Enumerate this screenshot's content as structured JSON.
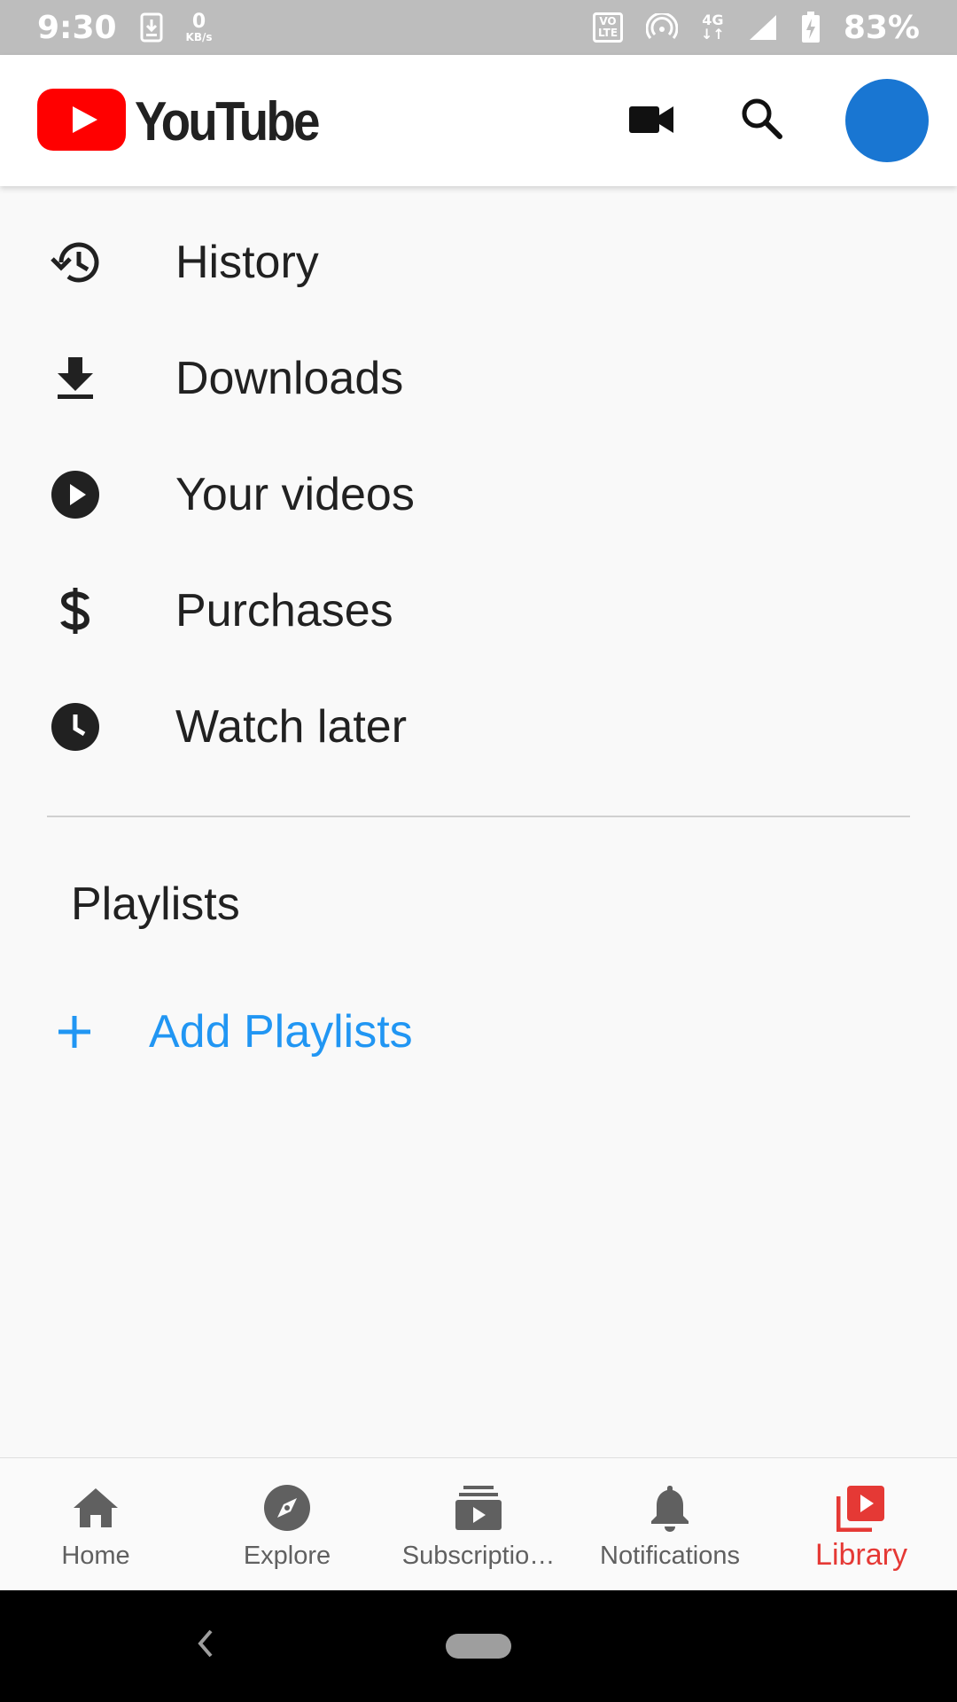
{
  "status_bar": {
    "time": "9:30",
    "net_speed_value": "0",
    "net_speed_unit": "KB/s",
    "volte_line1": "VO",
    "volte_line2": "LTE",
    "network_type": "4G",
    "battery_percent": "83%"
  },
  "app_bar": {
    "logo_text": "YouTube",
    "icons": [
      "video-camera-icon",
      "search-icon"
    ],
    "avatar_color": "#1976d2",
    "brand_red": "#ff0000"
  },
  "menu": {
    "items": [
      {
        "label": "History",
        "icon": "history-icon"
      },
      {
        "label": "Downloads",
        "icon": "download-icon"
      },
      {
        "label": "Your videos",
        "icon": "play-circle-icon"
      },
      {
        "label": "Purchases",
        "icon": "dollar-icon"
      },
      {
        "label": "Watch later",
        "icon": "clock-icon"
      }
    ]
  },
  "playlists": {
    "section_title": "Playlists",
    "add_label": "Add Playlists",
    "add_color": "#2196f3"
  },
  "bottom_nav": {
    "items": [
      {
        "label": "Home",
        "icon": "home-icon"
      },
      {
        "label": "Explore",
        "icon": "compass-icon"
      },
      {
        "label": "Subscriptio…",
        "icon": "subscriptions-icon"
      },
      {
        "label": "Notifications",
        "icon": "bell-icon"
      },
      {
        "label": "Library",
        "icon": "library-icon",
        "active": true
      }
    ],
    "active_color": "#e53935"
  }
}
